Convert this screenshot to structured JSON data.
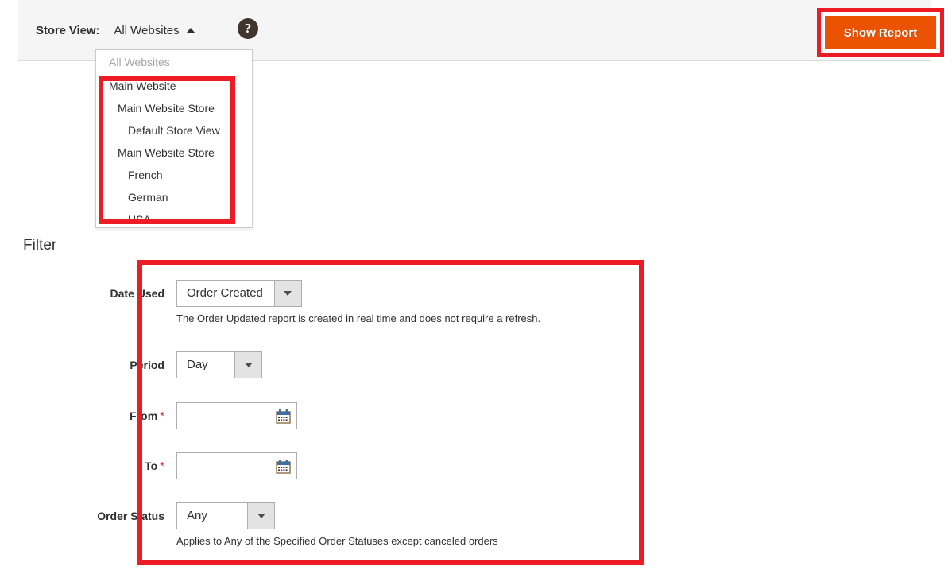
{
  "header": {
    "store_view_label": "Store View:",
    "store_view_value": "All Websites",
    "caret_icon": "caret-up-icon",
    "help_icon_glyph": "?",
    "show_report_label": "Show Report",
    "accent_orange": "#eb5202",
    "highlight_red": "#ed1c24",
    "bar_background": "#f5f5f5"
  },
  "store_dropdown": {
    "items": [
      {
        "label": "All Websites",
        "level": 0,
        "muted": true
      },
      {
        "label": "Main Website",
        "level": 0,
        "muted": false
      },
      {
        "label": "Main Website Store",
        "level": 1,
        "muted": false
      },
      {
        "label": "Default Store View",
        "level": 2,
        "muted": false
      },
      {
        "label": "Main Website Store",
        "level": 1,
        "muted": false
      },
      {
        "label": "French",
        "level": 2,
        "muted": false
      },
      {
        "label": "German",
        "level": 2,
        "muted": false
      },
      {
        "label": "USA",
        "level": 2,
        "muted": false
      }
    ]
  },
  "filter": {
    "title": "Filter",
    "date_used": {
      "label": "Date Used",
      "value": "Order Created",
      "note": "The Order Updated report is created in real time and does not require a refresh."
    },
    "period": {
      "label": "Period",
      "value": "Day"
    },
    "from": {
      "label": "From",
      "required_marker": "*",
      "value": "",
      "placeholder": "",
      "calendar_icon": "calendar-icon"
    },
    "to": {
      "label": "To",
      "required_marker": "*",
      "value": "",
      "placeholder": "",
      "calendar_icon": "calendar-icon"
    },
    "order_status": {
      "label": "Order Status",
      "value": "Any",
      "note": "Applies to Any of the Specified Order Statuses except canceled orders"
    }
  }
}
